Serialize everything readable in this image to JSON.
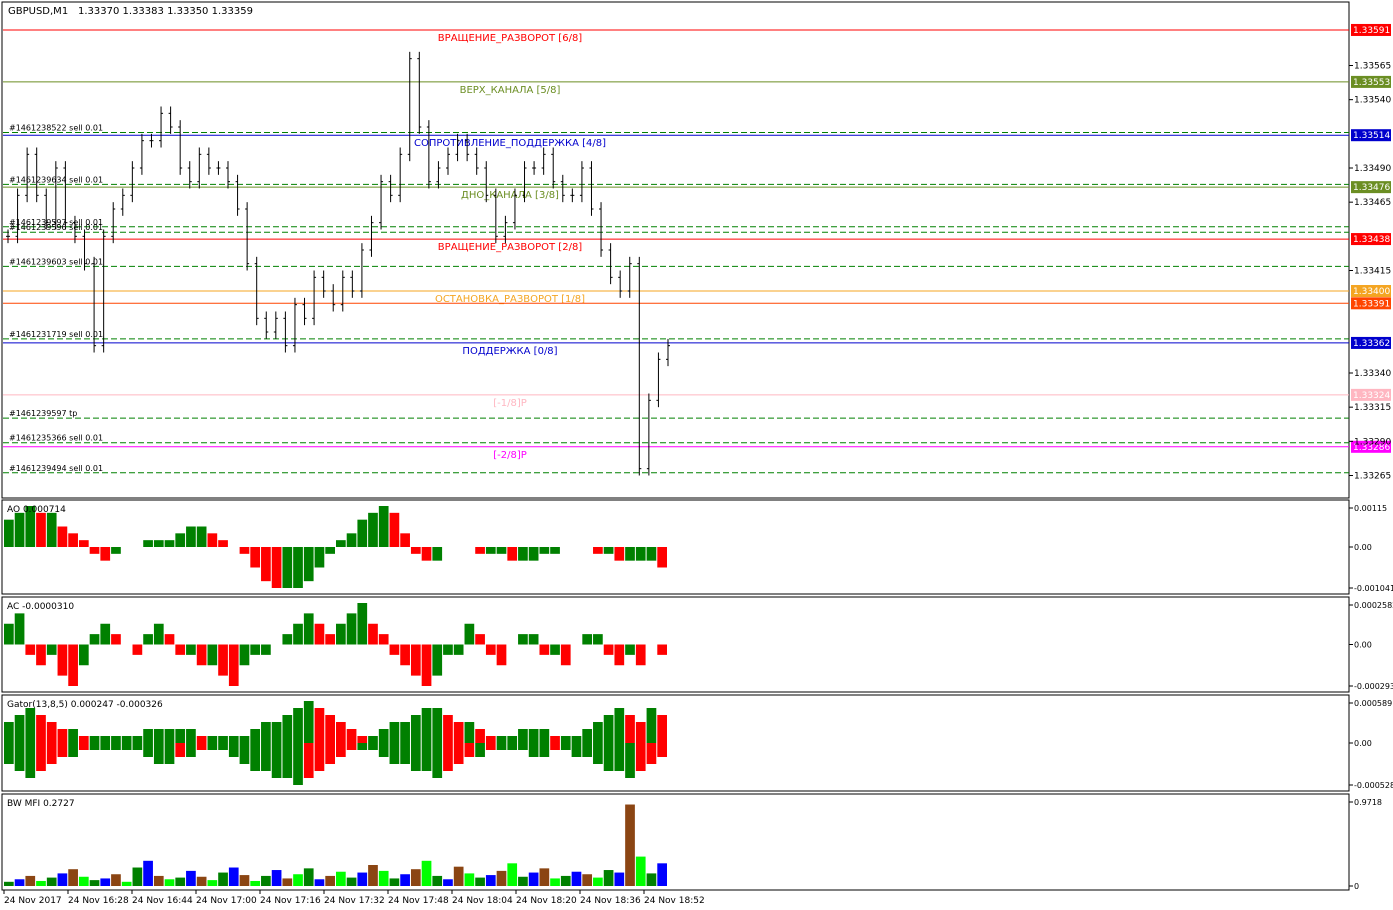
{
  "header": {
    "symbol": "GBPUSD,M1",
    "ohlc": "1.33370 1.33383 1.33350 1.33359"
  },
  "colors": {
    "background": "#ffffff",
    "frame": "#000000",
    "bull": "#008000",
    "bear": "#ff0000",
    "blue": "#0000ff",
    "mfi_bright_green": "#00ff00",
    "mfi_brown": "#8b4513"
  },
  "chart_data": [
    {
      "type": "candlestick",
      "panel": "price",
      "ylim": [
        1.3325,
        1.3361
      ],
      "y_ticks": [
        "1.33565",
        "1.33540",
        "1.33490",
        "1.33465",
        "1.33415",
        "1.33340",
        "1.33315",
        "1.33290",
        "1.33265"
      ],
      "y_values": [
        1.33565,
        1.3354,
        1.3349,
        1.33465,
        1.33415,
        1.3334,
        1.33315,
        1.3329,
        1.33265
      ],
      "x_labels": [
        "24 Nov 2017",
        "24 Nov 16:28",
        "24 Nov 16:44",
        "24 Nov 17:00",
        "24 Nov 17:16",
        "24 Nov 17:32",
        "24 Nov 17:48",
        "24 Nov 18:04",
        "24 Nov 18:20",
        "24 Nov 18:36",
        "24 Nov 18:52"
      ],
      "close_path": [
        1.3344,
        1.3347,
        1.335,
        1.3347,
        1.3345,
        1.3349,
        1.3345,
        1.3344,
        1.3342,
        1.3336,
        1.3344,
        1.3346,
        1.3347,
        1.3349,
        1.3351,
        1.3351,
        1.3353,
        1.3352,
        1.3349,
        1.3348,
        1.335,
        1.3349,
        1.3349,
        1.3348,
        1.3346,
        1.3342,
        1.3338,
        1.3337,
        1.3338,
        1.3336,
        1.3339,
        1.3338,
        1.3341,
        1.334,
        1.3339,
        1.3341,
        1.334,
        1.3343,
        1.3345,
        1.3348,
        1.3347,
        1.335,
        1.3357,
        1.3352,
        1.3348,
        1.3349,
        1.335,
        1.3351,
        1.335,
        1.3349,
        1.3347,
        1.3344,
        1.3345,
        1.3347,
        1.3349,
        1.3349,
        1.335,
        1.3348,
        1.3347,
        1.3347,
        1.3349,
        1.3346,
        1.3343,
        1.3341,
        1.334,
        1.3342,
        1.3327,
        1.3332,
        1.3335,
        1.3336
      ],
      "levels": [
        {
          "label": "ВРАЩЕНИЕ_РАЗВОРОТ [6/8]",
          "value": "1.33591",
          "price": 1.33591,
          "color": "#ff0000"
        },
        {
          "label": "ВЕРХ_КАНАЛА [5/8]",
          "value": "1.33553",
          "price": 1.33553,
          "color": "#6b8e23"
        },
        {
          "label": "СОПРОТИВЛЕНИЕ_ПОДДЕРЖКА [4/8]",
          "value": "1.33514",
          "price": 1.33514,
          "color": "#0000cd"
        },
        {
          "label": "ДНО_КАНАЛА [3/8]",
          "value": "1.33476",
          "price": 1.33476,
          "color": "#6b8e23"
        },
        {
          "label": "ВРАЩЕНИЕ_РАЗВОРОТ [2/8]",
          "value": "1.33438",
          "price": 1.33438,
          "color": "#ff0000"
        },
        {
          "label": "ОСТАНОВКА_РАЗВОРОТ [1/8]",
          "value": "1.33400",
          "price": 1.334,
          "color": "#f4a522"
        },
        {
          "label": "",
          "value": "1.33391",
          "price": 1.33391,
          "color": "#ff4500"
        },
        {
          "label": "ПОДДЕРЖКА [0/8]",
          "value": "1.33362",
          "price": 1.33362,
          "color": "#0000cd"
        },
        {
          "label": "[-1/8]P",
          "value": "1.33324",
          "price": 1.33324,
          "color": "#ffb6c1"
        },
        {
          "label": "[-2/8]P",
          "value": "1.33286",
          "price": 1.33286,
          "color": "#ff00ff"
        }
      ],
      "orders": [
        {
          "text": "#1461238522 sell 0.01",
          "price": 1.33516
        },
        {
          "text": "#1461239634 sell 0.01",
          "price": 1.33478
        },
        {
          "text": "#1461239597 sell 0.01",
          "price": 1.33447
        },
        {
          "text": "#1461239596 sell 0.01",
          "price": 1.33443
        },
        {
          "text": "#1461239603 sell 0.01",
          "price": 1.33418
        },
        {
          "text": "#1461231719 sell 0.01",
          "price": 1.33365
        },
        {
          "text": "#1461239597 tp",
          "price": 1.33307
        },
        {
          "text": "#1461235366 sell 0.01",
          "price": 1.33289
        },
        {
          "text": "#1461239494 sell 0.01",
          "price": 1.33267
        }
      ]
    },
    {
      "type": "bar",
      "panel": "oscillator",
      "name": "AO",
      "label": "AO 0.000714",
      "ticks": [
        "0.00115",
        "0.00",
        "-0.001041"
      ],
      "tick_values": [
        0.00115,
        0,
        -0.001041
      ],
      "values": [
        4,
        5,
        6,
        5,
        5,
        3,
        2,
        1,
        -1,
        -2,
        -1,
        0,
        0,
        1,
        1,
        1,
        2,
        3,
        3,
        2,
        1,
        0,
        -1,
        -3,
        -5,
        -6,
        -6,
        -6,
        -5,
        -3,
        -1,
        1,
        2,
        4,
        5,
        6,
        5,
        2,
        -1,
        -2,
        -2,
        0,
        0,
        0,
        -1,
        -1,
        -1,
        -2,
        -2,
        -2,
        -1,
        -1,
        0,
        0,
        0,
        -1,
        -1,
        -2,
        -2,
        -2,
        -2,
        -3
      ]
    },
    {
      "type": "bar",
      "panel": "oscillator",
      "name": "AC",
      "label": "AC -0.0000310",
      "ticks": [
        "0.0002582",
        "0.00",
        "-0.000293"
      ],
      "tick_values": [
        0.0002582,
        0,
        -0.000293
      ],
      "values": [
        2,
        3,
        -1,
        -2,
        -1,
        -3,
        -4,
        -2,
        1,
        2,
        1,
        0,
        -1,
        1,
        2,
        1,
        -1,
        -1,
        -2,
        -2,
        -3,
        -4,
        -2,
        -1,
        -1,
        0,
        1,
        2,
        3,
        2,
        1,
        2,
        3,
        4,
        2,
        1,
        -1,
        -2,
        -3,
        -4,
        -3,
        -1,
        -1,
        2,
        1,
        -1,
        -2,
        0,
        1,
        1,
        -1,
        -1,
        -2,
        0,
        1,
        1,
        -1,
        -2,
        -1,
        -2,
        0,
        -1
      ]
    },
    {
      "type": "bar",
      "panel": "oscillator",
      "name": "Gator",
      "label": "Gator(13,8,5) 0.000247 -0.000326",
      "ticks": [
        "0.000589",
        "0.00",
        "-0.000528"
      ],
      "tick_values": [
        0.000589,
        0,
        -0.000528
      ],
      "upper": [
        3,
        4,
        5,
        4,
        3,
        2,
        2,
        1,
        1,
        1,
        1,
        1,
        1,
        2,
        2,
        2,
        2,
        2,
        1,
        1,
        1,
        1,
        1,
        2,
        3,
        3,
        4,
        5,
        6,
        5,
        4,
        3,
        2,
        1,
        1,
        2,
        3,
        3,
        4,
        5,
        5,
        4,
        3,
        3,
        2,
        1,
        1,
        1,
        2,
        2,
        2,
        1,
        1,
        1,
        2,
        3,
        4,
        5,
        4,
        3,
        5,
        4
      ],
      "lower": [
        -3,
        -4,
        -5,
        -4,
        -3,
        -2,
        -2,
        -1,
        -1,
        -1,
        -1,
        -1,
        -1,
        -2,
        -3,
        -3,
        -2,
        -2,
        -1,
        -1,
        -1,
        -2,
        -3,
        -4,
        -4,
        -5,
        -5,
        -6,
        -5,
        -4,
        -3,
        -2,
        -1,
        -1,
        -1,
        -2,
        -3,
        -3,
        -4,
        -4,
        -5,
        -4,
        -3,
        -2,
        -2,
        -1,
        -1,
        -1,
        -1,
        -2,
        -2,
        -1,
        -1,
        -2,
        -2,
        -3,
        -4,
        -4,
        -5,
        -4,
        -3,
        -2
      ]
    },
    {
      "type": "bar",
      "panel": "oscillator",
      "name": "BW MFI",
      "label": "BW MFI 0.2727",
      "ticks": [
        "0.9718",
        "0"
      ],
      "tick_values": [
        0.9718,
        0
      ],
      "values": [
        0.05,
        0.08,
        0.12,
        0.06,
        0.1,
        0.15,
        0.2,
        0.11,
        0.07,
        0.09,
        0.14,
        0.05,
        0.22,
        0.3,
        0.12,
        0.08,
        0.1,
        0.18,
        0.11,
        0.07,
        0.16,
        0.22,
        0.13,
        0.06,
        0.12,
        0.19,
        0.09,
        0.14,
        0.21,
        0.08,
        0.12,
        0.17,
        0.1,
        0.16,
        0.25,
        0.18,
        0.09,
        0.14,
        0.2,
        0.3,
        0.12,
        0.08,
        0.23,
        0.15,
        0.1,
        0.13,
        0.18,
        0.27,
        0.11,
        0.16,
        0.21,
        0.09,
        0.12,
        0.17,
        0.14,
        0.1,
        0.19,
        0.16,
        0.97,
        0.35,
        0.15,
        0.27
      ]
    }
  ]
}
